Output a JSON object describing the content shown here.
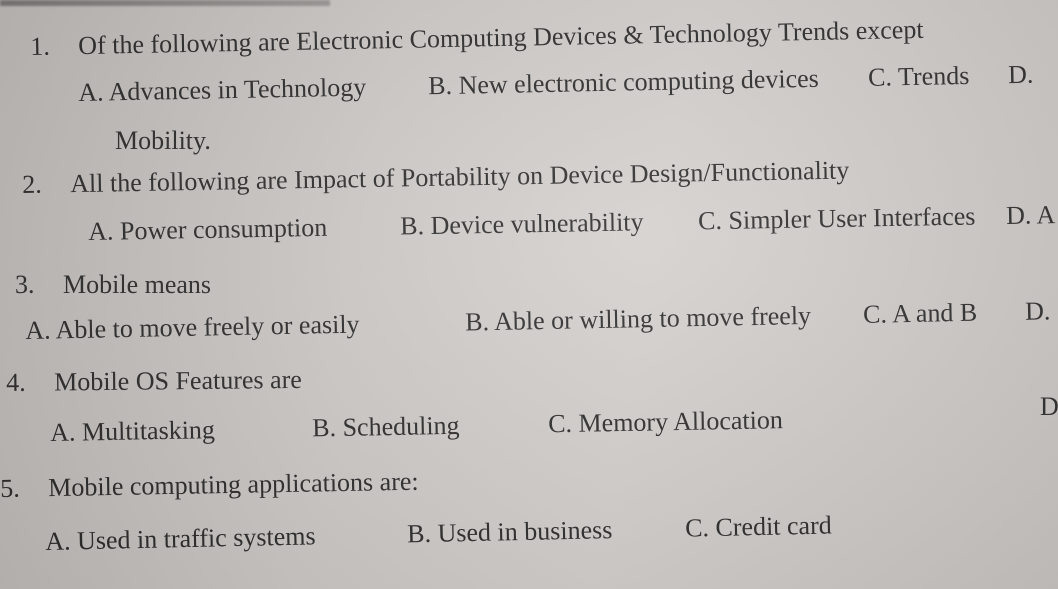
{
  "questions": [
    {
      "number": "1.",
      "text": "Of the following are  Electronic Computing Devices & Technology Trends  except",
      "options": [
        "A. Advances in Technology",
        "B. New electronic computing devices",
        "C. Trends",
        "D.",
        "Mobility."
      ]
    },
    {
      "number": "2.",
      "text": "All the following are Impact of Portability on Device Design/Functionality",
      "options": [
        "A. Power consumption",
        "B. Device vulnerability",
        "C. Simpler User Interfaces",
        "D. A"
      ]
    },
    {
      "number": "3.",
      "text": "Mobile means",
      "options": [
        "A. Able to move freely or easily",
        "B. Able or willing to move freely",
        "C. A and B",
        "D."
      ]
    },
    {
      "number": "4.",
      "text": "Mobile OS Features  are",
      "options": [
        "A. Multitasking",
        "B. Scheduling",
        "C. Memory Allocation",
        "D"
      ]
    },
    {
      "number": "5.",
      "text": "Mobile computing applications are:",
      "options": [
        "A. Used in traffic systems",
        "B. Used in business",
        "C. Credit card"
      ]
    }
  ]
}
